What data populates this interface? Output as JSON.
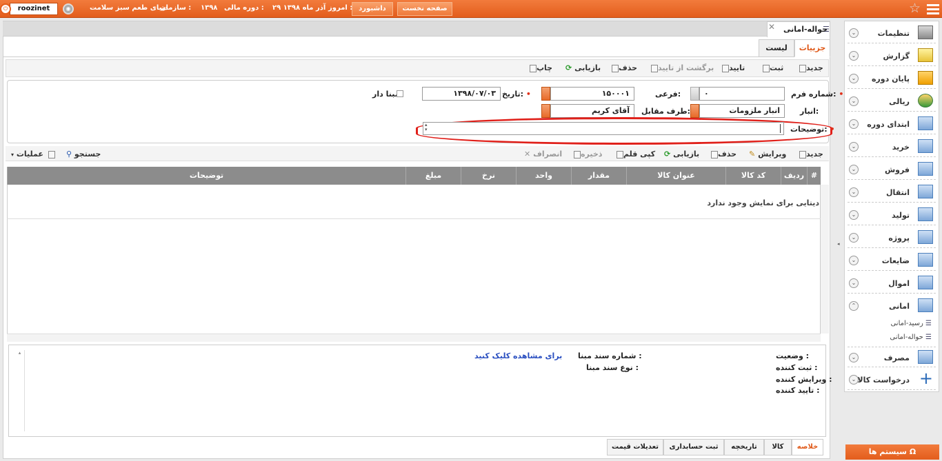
{
  "topbar": {
    "user": "roozinet",
    "org_label": "سازمان :",
    "org_value": "دنیای طعم سبز سلامت",
    "period_label": "دوره مالی :",
    "period_value": "۱۳۹۸",
    "today_label": "امروز :",
    "today_value": "۲۹ آذر ماه ۱۳۹۸",
    "dashboard": "داشبورد",
    "home": "صفحه نخست"
  },
  "window": {
    "title": "حواله-امانی",
    "tabs": [
      "جزییات",
      "لیست"
    ]
  },
  "toolbar": [
    "جدید",
    "ثبت",
    "تایید",
    "برگشت از تایید",
    "حذف",
    "بازیابی",
    "چاپ"
  ],
  "form": {
    "form_no_label": "شماره فرم:",
    "form_no_value": "۰",
    "sub_label": "فرعی:",
    "sub_value": "۱۵۰۰۰۱",
    "date_label": "تاریخ:",
    "date_value": "۱۳۹۸/۰۷/۰۳",
    "mabna_label": "مبنا دار",
    "anbar_label": "انبار:",
    "anbar_value": "انبار ملزومات",
    "party_label": "طرف مقابل:",
    "party_value": "آقای کریم",
    "desc_label": "توضیحات:"
  },
  "item_toolbar": [
    "جدید",
    "ویرایش",
    "حذف",
    "بازیابی",
    "کپی قلم",
    "ذخیره",
    "انصراف"
  ],
  "item_toolbar_left": [
    "جستجو",
    "عملیات"
  ],
  "grid": {
    "columns": [
      "#",
      "ردیف",
      "کد کالا",
      "عنوان کالا",
      "مقدار",
      "واحد",
      "نرخ",
      "مبلغ",
      "توضیحات"
    ],
    "empty_text": "دیتایی برای نمایش وجود ندارد"
  },
  "summary": {
    "status_label": "وضعیت :",
    "creator_label": "ثبت کننده :",
    "editor_label": "ویرایش کننده :",
    "approver_label": "تایید کننده :",
    "source_no_label": "شماره سند مبنا :",
    "source_type_label": "نوع سند مبنا :",
    "view_link": "برای مشاهده کلیک کنید"
  },
  "bottom_tabs": [
    "خلاصه",
    "کالا",
    "تاریخچه",
    "ثبت حسابداری",
    "تعدیلات قیمت"
  ],
  "sidebar": {
    "items": [
      "تنظیمات",
      "گزارش",
      "پایان دوره",
      "ریالی",
      "ابتدای دوره",
      "خرید",
      "فروش",
      "انتقال",
      "تولید",
      "پروژه",
      "ضایعات",
      "اموال",
      "امانی",
      "مصرف",
      "درخواست کالا"
    ],
    "subitems": [
      "رسید-امانی",
      "حواله-امانی"
    ],
    "system_button": "سیستم ها"
  },
  "colors": {
    "accent": "#e8662a",
    "highlight": "#e0201a",
    "grid_header": "#8c8c8c",
    "link": "#2a4fc0"
  }
}
